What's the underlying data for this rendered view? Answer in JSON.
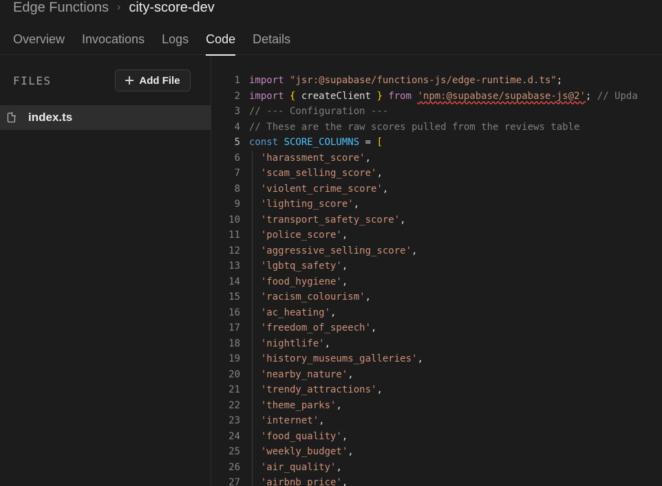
{
  "breadcrumb": {
    "parent": "Edge Functions",
    "separator": "›",
    "current": "city-score-dev"
  },
  "tabs": [
    {
      "label": "Overview",
      "active": false
    },
    {
      "label": "Invocations",
      "active": false
    },
    {
      "label": "Logs",
      "active": false
    },
    {
      "label": "Code",
      "active": true
    },
    {
      "label": "Details",
      "active": false
    }
  ],
  "sidebar": {
    "files_label": "FILES",
    "add_file_label": "Add File",
    "files": [
      {
        "name": "index.ts",
        "icon": "file-icon",
        "selected": true
      }
    ]
  },
  "editor": {
    "lines": [
      {
        "n": "1",
        "code": [
          {
            "t": "import ",
            "c": "kw2"
          },
          {
            "t": "\"jsr:@supabase/functions-js/edge-runtime.d.ts\"",
            "c": "str"
          },
          {
            "t": ";",
            "c": "id"
          }
        ]
      },
      {
        "n": "2",
        "code": [
          {
            "t": "import ",
            "c": "kw2"
          },
          {
            "t": "{ ",
            "c": "br"
          },
          {
            "t": "createClient ",
            "c": "id"
          },
          {
            "t": "} ",
            "c": "br"
          },
          {
            "t": "from ",
            "c": "kw2"
          },
          {
            "t": "'npm:@supabase/supabase-js@2'",
            "c": "str squiggle"
          },
          {
            "t": "; ",
            "c": "id"
          },
          {
            "t": "// Upda",
            "c": "cm-gray"
          }
        ]
      },
      {
        "n": "3",
        "code": [
          {
            "t": "// --- Configuration ---",
            "c": "cm-gray"
          }
        ]
      },
      {
        "n": "4",
        "code": [
          {
            "t": "// These are the raw scores pulled from the reviews table",
            "c": "cm-gray"
          }
        ]
      },
      {
        "n": "5",
        "code": [
          {
            "t": "const ",
            "c": "kw"
          },
          {
            "t": "SCORE_COLUMNS",
            "c": "const"
          },
          {
            "t": " = ",
            "c": "id"
          },
          {
            "t": "[",
            "c": "br"
          }
        ]
      },
      {
        "n": "6",
        "code": [
          {
            "t": "  'harassment_score'",
            "c": "str"
          },
          {
            "t": ",",
            "c": "id"
          }
        ],
        "guide": true
      },
      {
        "n": "7",
        "code": [
          {
            "t": "  'scam_selling_score'",
            "c": "str"
          },
          {
            "t": ",",
            "c": "id"
          }
        ],
        "guide": true
      },
      {
        "n": "8",
        "code": [
          {
            "t": "  'violent_crime_score'",
            "c": "str"
          },
          {
            "t": ",",
            "c": "id"
          }
        ],
        "guide": true
      },
      {
        "n": "9",
        "code": [
          {
            "t": "  'lighting_score'",
            "c": "str"
          },
          {
            "t": ",",
            "c": "id"
          }
        ],
        "guide": true
      },
      {
        "n": "10",
        "code": [
          {
            "t": "  'transport_safety_score'",
            "c": "str"
          },
          {
            "t": ",",
            "c": "id"
          }
        ],
        "guide": true
      },
      {
        "n": "11",
        "code": [
          {
            "t": "  'police_score'",
            "c": "str"
          },
          {
            "t": ",",
            "c": "id"
          }
        ],
        "guide": true
      },
      {
        "n": "12",
        "code": [
          {
            "t": "  'aggressive_selling_score'",
            "c": "str"
          },
          {
            "t": ",",
            "c": "id"
          }
        ],
        "guide": true
      },
      {
        "n": "13",
        "code": [
          {
            "t": "  'lgbtq_safety'",
            "c": "str"
          },
          {
            "t": ",",
            "c": "id"
          }
        ],
        "guide": true
      },
      {
        "n": "14",
        "code": [
          {
            "t": "  'food_hygiene'",
            "c": "str"
          },
          {
            "t": ",",
            "c": "id"
          }
        ],
        "guide": true
      },
      {
        "n": "15",
        "code": [
          {
            "t": "  'racism_colourism'",
            "c": "str"
          },
          {
            "t": ",",
            "c": "id"
          }
        ],
        "guide": true
      },
      {
        "n": "16",
        "code": [
          {
            "t": "  'ac_heating'",
            "c": "str"
          },
          {
            "t": ",",
            "c": "id"
          }
        ],
        "guide": true
      },
      {
        "n": "17",
        "code": [
          {
            "t": "  'freedom_of_speech'",
            "c": "str"
          },
          {
            "t": ",",
            "c": "id"
          }
        ],
        "guide": true
      },
      {
        "n": "18",
        "code": [
          {
            "t": "  'nightlife'",
            "c": "str"
          },
          {
            "t": ",",
            "c": "id"
          }
        ],
        "guide": true
      },
      {
        "n": "19",
        "code": [
          {
            "t": "  'history_museums_galleries'",
            "c": "str"
          },
          {
            "t": ",",
            "c": "id"
          }
        ],
        "guide": true
      },
      {
        "n": "20",
        "code": [
          {
            "t": "  'nearby_nature'",
            "c": "str"
          },
          {
            "t": ",",
            "c": "id"
          }
        ],
        "guide": true
      },
      {
        "n": "21",
        "code": [
          {
            "t": "  'trendy_attractions'",
            "c": "str"
          },
          {
            "t": ",",
            "c": "id"
          }
        ],
        "guide": true
      },
      {
        "n": "22",
        "code": [
          {
            "t": "  'theme_parks'",
            "c": "str"
          },
          {
            "t": ",",
            "c": "id"
          }
        ],
        "guide": true
      },
      {
        "n": "23",
        "code": [
          {
            "t": "  'internet'",
            "c": "str"
          },
          {
            "t": ",",
            "c": "id"
          }
        ],
        "guide": true
      },
      {
        "n": "24",
        "code": [
          {
            "t": "  'food_quality'",
            "c": "str"
          },
          {
            "t": ",",
            "c": "id"
          }
        ],
        "guide": true
      },
      {
        "n": "25",
        "code": [
          {
            "t": "  'weekly_budget'",
            "c": "str"
          },
          {
            "t": ",",
            "c": "id"
          }
        ],
        "guide": true
      },
      {
        "n": "26",
        "code": [
          {
            "t": "  'air_quality'",
            "c": "str"
          },
          {
            "t": ",",
            "c": "id"
          }
        ],
        "guide": true
      },
      {
        "n": "27",
        "code": [
          {
            "t": "  'airbnb_price'",
            "c": "str"
          },
          {
            "t": ",",
            "c": "id"
          }
        ],
        "guide": true
      }
    ]
  }
}
